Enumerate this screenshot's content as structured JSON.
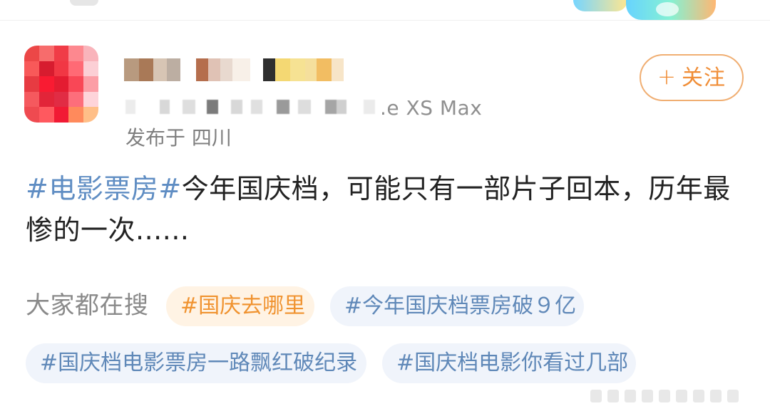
{
  "header": {
    "top_banner_icon": "decorative-sky-banner"
  },
  "post": {
    "avatar_icon": "pixelated-avatar",
    "follow_button": {
      "icon": "+",
      "label": "关注"
    },
    "device_suffix": ".e XS Max",
    "location_text": "发布于 四川",
    "content": {
      "hashtag": "#电影票房#",
      "text_line_1": "今年国庆档，可能只有一部片子回本，历年最",
      "text_line_2": "惨的一次......"
    },
    "search": {
      "label": "大家都在搜",
      "tags": [
        "#国庆去哪里",
        "#今年国庆档票房破９亿",
        "#国庆档电影票房一路飘红破纪录",
        "#国庆档电影你看过几部"
      ]
    }
  },
  "colors": {
    "background": "#ffffff",
    "hashtag": "#5f8dc3",
    "follow_orange": "#f08d36",
    "hot_tag_background": "#fff3e4",
    "tag_background": "#f0f4fb",
    "text": "#222222",
    "muted_text": "#8a8a8a"
  }
}
